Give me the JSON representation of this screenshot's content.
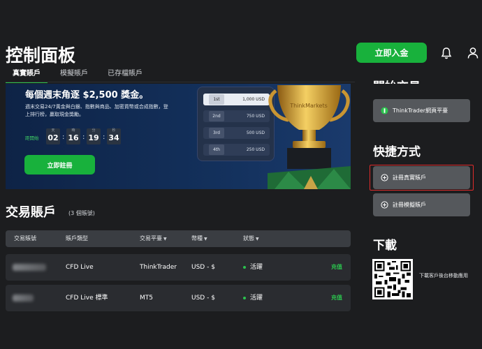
{
  "header": {
    "title": "控制面板",
    "deposit_label": "立即入金",
    "bell_icon": "bell-icon",
    "user_icon": "user-icon"
  },
  "tabs": [
    {
      "label": "真實賬戶",
      "active": true
    },
    {
      "label": "模擬賬戶",
      "active": false
    },
    {
      "label": "已存檔賬戶",
      "active": false
    }
  ],
  "banner": {
    "title": "每個週末角逐 $2,500 獎金。",
    "desc": "週末交易24/7黃金與白銀、指數與商品、加密貨幣或合成指數，登上排行榜，贏取現金獎勵。",
    "countdown_label": "距開始",
    "countdown": [
      {
        "unit": "天",
        "value": "02"
      },
      {
        "unit": "時",
        "value": "16"
      },
      {
        "unit": "分",
        "value": "19"
      },
      {
        "unit": "秒",
        "value": "34"
      }
    ],
    "register_label": "立即註冊",
    "prizes": [
      {
        "place": "1st",
        "amount": "1,000 USD"
      },
      {
        "place": "2nd",
        "amount": "750 USD"
      },
      {
        "place": "3rd",
        "amount": "500 USD"
      },
      {
        "place": "4th",
        "amount": "250 USD"
      }
    ],
    "trophy_text": "ThinkMarkets"
  },
  "accounts": {
    "title": "交易賬戶",
    "count": "(3 個賬號)",
    "columns": [
      {
        "label": "交易賬號",
        "sortable": false
      },
      {
        "label": "賬戶類型",
        "sortable": false
      },
      {
        "label": "交易平臺",
        "sortable": true
      },
      {
        "label": "幣種",
        "sortable": true
      },
      {
        "label": "狀態",
        "sortable": true
      }
    ],
    "rows": [
      {
        "account": "",
        "type": "CFD Live",
        "platform": "ThinkTrader",
        "currency": "USD - $",
        "status": "活躍",
        "action": "充值"
      },
      {
        "account": "",
        "type": "CFD Live 標準",
        "platform": "MT5",
        "currency": "USD - $",
        "status": "活躍",
        "action": "充值"
      }
    ]
  },
  "sidebar": {
    "start_title": "開始交易",
    "tt_web_label": "ThinkTrader網頁平臺",
    "shortcuts_title": "快捷方式",
    "register_live_label": "註冊真實賬戶",
    "register_demo_label": "註冊模擬賬戶",
    "download_title": "下載",
    "download_text": "下載客戶後台移動應用"
  },
  "colors": {
    "accent_green": "#18b13c",
    "highlight_red": "#e02b2b",
    "background": "#1c1d1f"
  }
}
